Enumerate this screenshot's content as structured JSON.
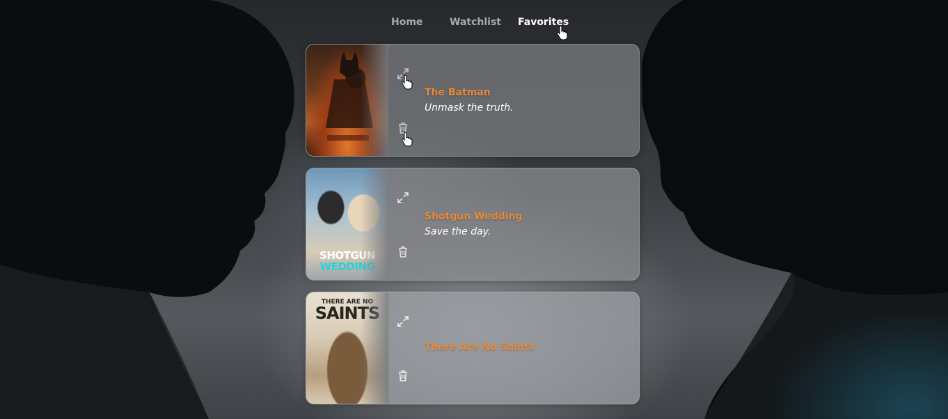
{
  "nav": {
    "items": [
      {
        "label": "Home",
        "active": false
      },
      {
        "label": "Watchlist",
        "active": false
      },
      {
        "label": "Favorites",
        "active": true
      }
    ]
  },
  "favorites": [
    {
      "title": "The Batman",
      "tagline": "Unmask the truth.",
      "poster": "the-batman-poster"
    },
    {
      "title": "Shotgun Wedding",
      "tagline": "Save the day.",
      "poster": "shotgun-wedding-poster",
      "poster_text": [
        "SHOTGUN",
        "WEDDING"
      ]
    },
    {
      "title": "There Are No Saints",
      "tagline": "",
      "poster": "there-are-no-saints-poster",
      "poster_text": [
        "THERE ARE NO",
        "SAINTS"
      ]
    }
  ],
  "icons": {
    "expand": "expand-icon",
    "delete": "trash-icon",
    "cursor": "hand-pointer-icon"
  },
  "colors": {
    "title_accent": "#e8893a",
    "nav_active": "#ffffff",
    "nav_inactive": "#a7a9ac",
    "teal_poster_text": "#2ad1d6"
  }
}
